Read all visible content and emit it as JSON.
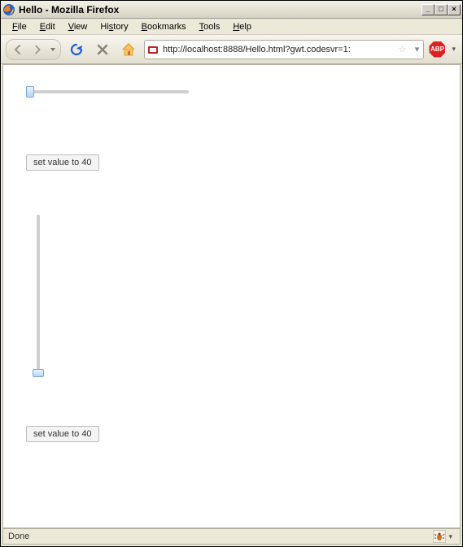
{
  "window": {
    "title": "Hello - Mozilla Firefox",
    "buttons": {
      "min": "_",
      "max": "□",
      "close": "×"
    }
  },
  "menu": {
    "items": [
      {
        "label": "File",
        "accel": "F"
      },
      {
        "label": "Edit",
        "accel": "E"
      },
      {
        "label": "View",
        "accel": "V"
      },
      {
        "label": "History",
        "accel": "s"
      },
      {
        "label": "Bookmarks",
        "accel": "B"
      },
      {
        "label": "Tools",
        "accel": "T"
      },
      {
        "label": "Help",
        "accel": "H"
      }
    ]
  },
  "toolbar": {
    "back_tip": "Back",
    "fwd_tip": "Forward",
    "recent_tip": "Recent pages",
    "reload_tip": "Reload",
    "stop_tip": "Stop",
    "home_tip": "Home",
    "url": "http://localhost:8888/Hello.html?gwt.codesvr=1:",
    "bookmark_tip": "Bookmark this page",
    "abp_label": "ABP"
  },
  "page": {
    "hslider_value": 0,
    "button1_label": "set value to 40",
    "vslider_value": 0,
    "button2_label": "set value to 40"
  },
  "status": {
    "text": "Done",
    "firebug_tip": "Firebug"
  },
  "colors": {
    "chrome_bg": "#ece9d8",
    "slider_thumb": "#b9d4f3"
  }
}
